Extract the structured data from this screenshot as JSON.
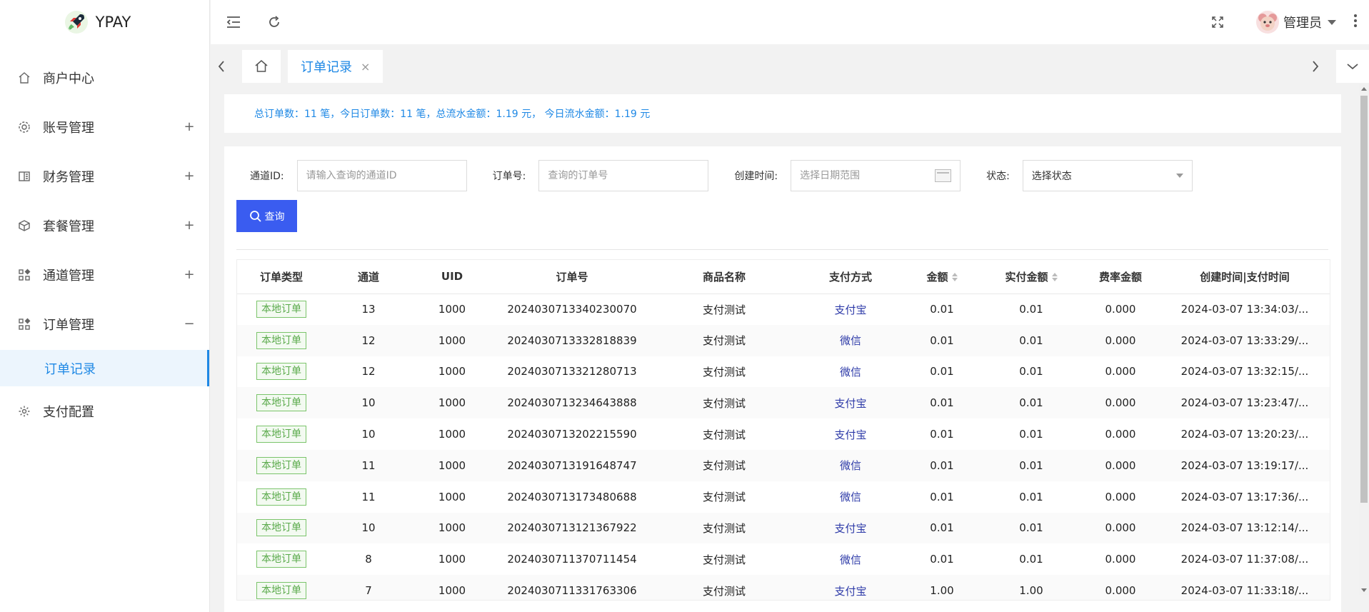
{
  "app": {
    "name": "YPAY"
  },
  "sidebar": {
    "items": [
      {
        "label": "商户中心",
        "icon": "home-icon",
        "toggle": ""
      },
      {
        "label": "账号管理",
        "icon": "gear-icon",
        "toggle": "+"
      },
      {
        "label": "财务管理",
        "icon": "ledger-icon",
        "toggle": "+"
      },
      {
        "label": "套餐管理",
        "icon": "box-icon",
        "toggle": "+"
      },
      {
        "label": "通道管理",
        "icon": "grid-icon",
        "toggle": "+"
      },
      {
        "label": "订单管理",
        "icon": "grid-icon",
        "toggle": "−"
      },
      {
        "label": "支付配置",
        "icon": "settings-icon",
        "toggle": ""
      }
    ],
    "subitem": {
      "label": "订单记录"
    }
  },
  "header": {
    "user": "管理员"
  },
  "tabs": {
    "active": "订单记录",
    "close": "×"
  },
  "summary": {
    "text": "总订单数：11 笔，今日订单数：11 笔，总流水金额：1.19 元， 今日流水金额：1.19 元"
  },
  "filters": {
    "channel_label": "通道ID:",
    "channel_placeholder": "请输入查询的通道ID",
    "order_label": "订单号:",
    "order_placeholder": "查询的订单号",
    "time_label": "创建时间:",
    "time_placeholder": "选择日期范围",
    "status_label": "状态:",
    "status_value": "选择状态",
    "search_label": "查询"
  },
  "table": {
    "headers": [
      "订单类型",
      "通道",
      "UID",
      "订单号",
      "商品名称",
      "支付方式",
      "金额",
      "实付金额",
      "费率金额",
      "创建时间|支付时间"
    ],
    "rows": [
      [
        "本地订单",
        "13",
        "1000",
        "2024030713340230070",
        "支付测试",
        "支付宝",
        "0.01",
        "0.01",
        "0.000",
        "2024-03-07 13:34:03/..."
      ],
      [
        "本地订单",
        "12",
        "1000",
        "2024030713332818839",
        "支付测试",
        "微信",
        "0.01",
        "0.01",
        "0.000",
        "2024-03-07 13:33:29/..."
      ],
      [
        "本地订单",
        "12",
        "1000",
        "2024030713321280713",
        "支付测试",
        "微信",
        "0.01",
        "0.01",
        "0.000",
        "2024-03-07 13:32:15/..."
      ],
      [
        "本地订单",
        "10",
        "1000",
        "2024030713234643888",
        "支付测试",
        "支付宝",
        "0.01",
        "0.01",
        "0.000",
        "2024-03-07 13:23:47/..."
      ],
      [
        "本地订单",
        "10",
        "1000",
        "2024030713202215590",
        "支付测试",
        "支付宝",
        "0.01",
        "0.01",
        "0.000",
        "2024-03-07 13:20:23/..."
      ],
      [
        "本地订单",
        "11",
        "1000",
        "2024030713191648747",
        "支付测试",
        "微信",
        "0.01",
        "0.01",
        "0.000",
        "2024-03-07 13:19:17/..."
      ],
      [
        "本地订单",
        "11",
        "1000",
        "2024030713173480688",
        "支付测试",
        "微信",
        "0.01",
        "0.01",
        "0.000",
        "2024-03-07 13:17:36/..."
      ],
      [
        "本地订单",
        "10",
        "1000",
        "2024030713121367922",
        "支付测试",
        "支付宝",
        "0.01",
        "0.01",
        "0.000",
        "2024-03-07 13:12:14/..."
      ],
      [
        "本地订单",
        "8",
        "1000",
        "2024030711370711454",
        "支付测试",
        "微信",
        "0.01",
        "0.01",
        "0.000",
        "2024-03-07 11:37:08/..."
      ],
      [
        "本地订单",
        "7",
        "1000",
        "2024030711331763306",
        "支付测试",
        "支付宝",
        "1.00",
        "1.00",
        "0.000",
        "2024-03-07 11:33:18/..."
      ]
    ]
  },
  "colors": {
    "accent": "#1e88e5",
    "button": "#3a5cf0",
    "badge": "#5aaa4b",
    "pay": "#2d3aa8"
  }
}
